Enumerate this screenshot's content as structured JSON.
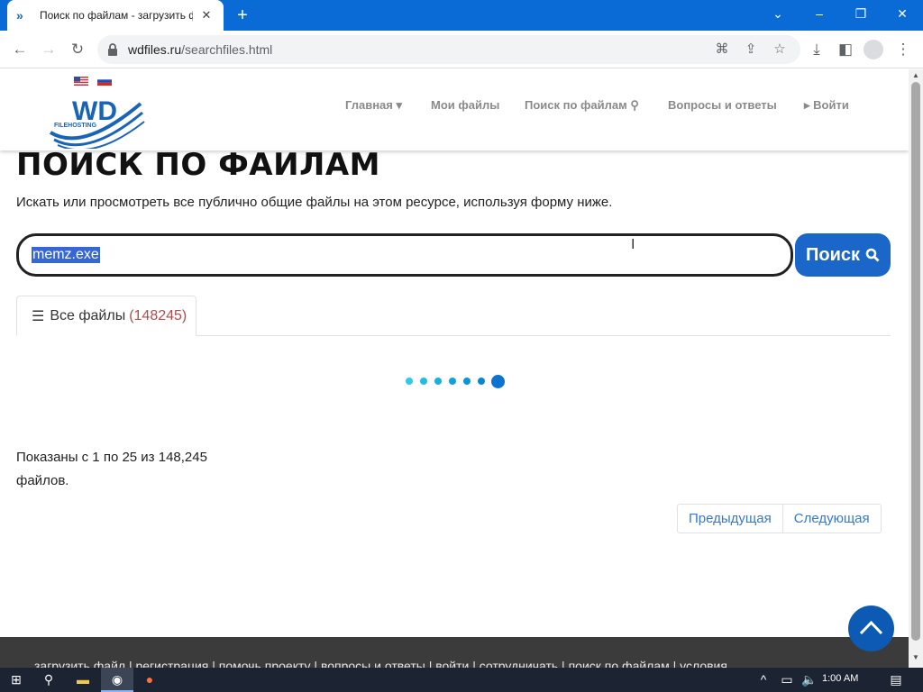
{
  "browser": {
    "tab_title": "Поиск по файлам - загрузить ф",
    "url_host": "wdfiles.ru",
    "url_path": "/searchfiles.html"
  },
  "site": {
    "logo_text": "WD",
    "logo_subtext": "FILEHOSTING",
    "nav": {
      "home": "Главная",
      "my_files": "Мои файлы",
      "search": "Поиск по файлам",
      "faq": "Вопросы и ответы",
      "login": "Войти"
    }
  },
  "main": {
    "title": "ПОИСК ПО ФАЙЛАМ",
    "subtitle": "Искать или просмотреть все публично общие файлы на этом ресурсе, используя форму ниже.",
    "search_value": "memz.exe",
    "search_button": "Поиск",
    "tab_label": "Все файлы",
    "tab_count": "(148245)",
    "shown_text": "Показаны с 1 по 25 из 148,245 файлов.",
    "prev": "Предыдущая",
    "next": "Следующая"
  },
  "footer": {
    "links_text": "загрузить файл | регистрация | помочь проекту | вопросы и ответы | войти | сотрудничать | поиск по файлам | условия"
  },
  "taskbar": {
    "time": "1:00 AM"
  },
  "colors": {
    "chrome_frame": "#0a6bd6",
    "primary_button": "#1b66c9",
    "selection": "#3767d3",
    "count": "#b34a4a",
    "footer": "#3b3b3b"
  }
}
